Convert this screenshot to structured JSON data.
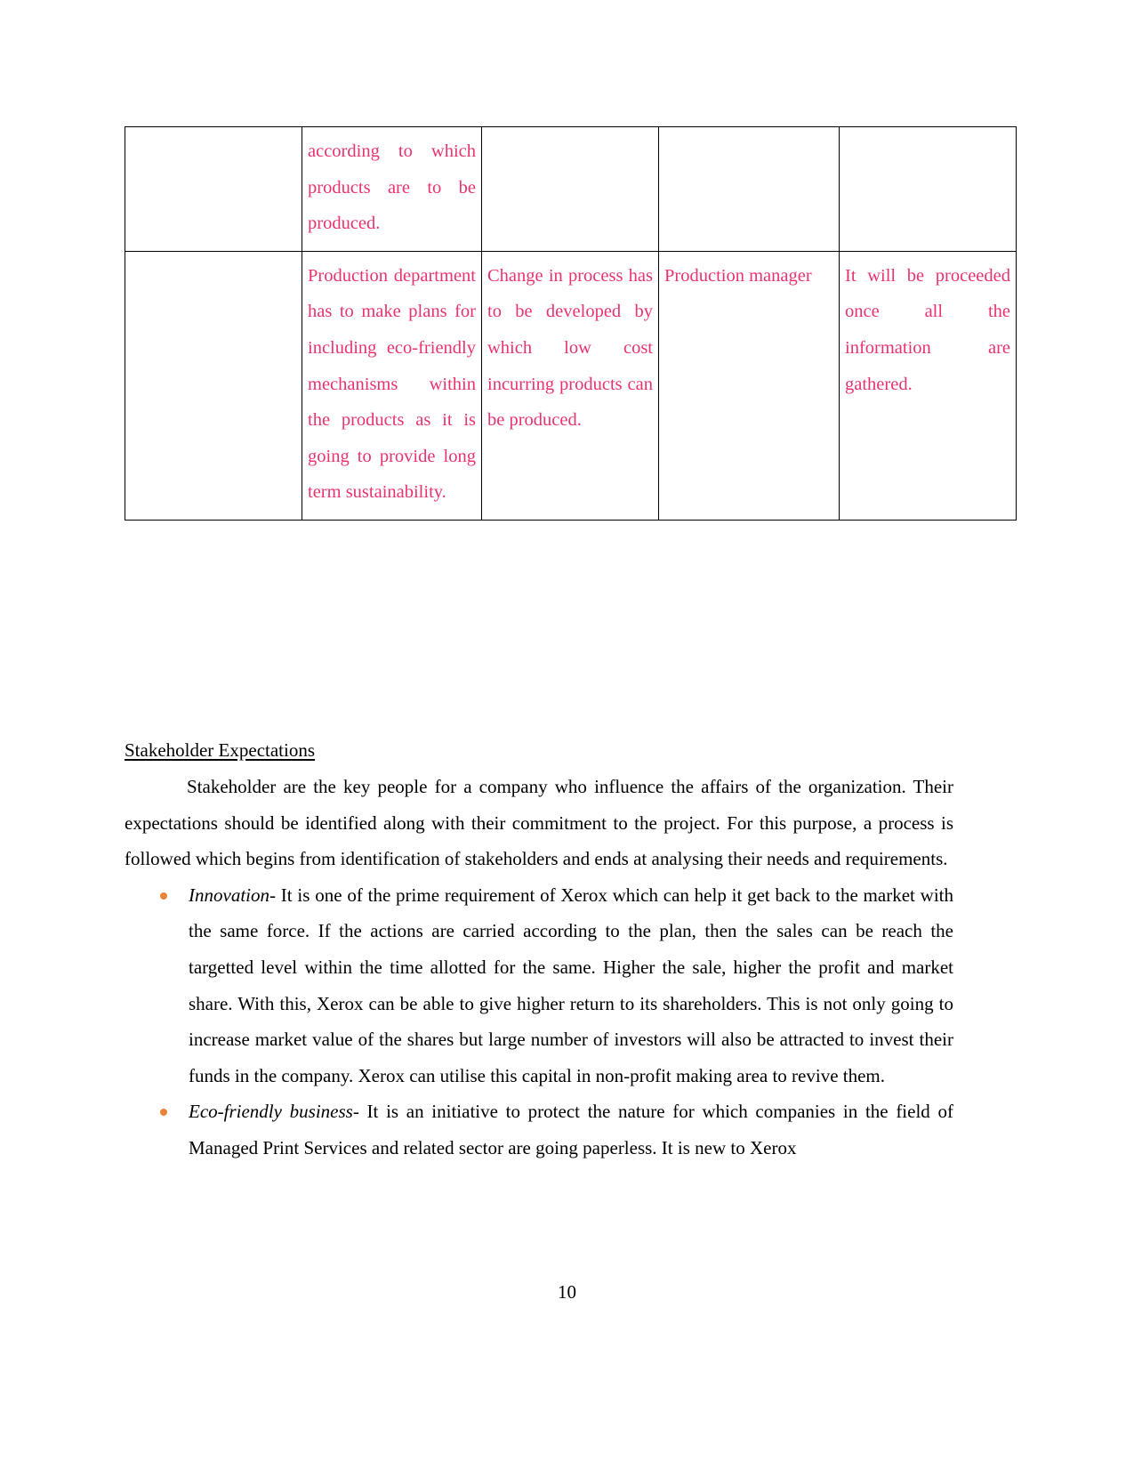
{
  "page": {
    "number": "10",
    "table_text_color": "#E8336D",
    "bullet_color": "#E8833A",
    "body_text_color": "#000000"
  },
  "table": {
    "rows": [
      {
        "cells": [
          {
            "text": ""
          },
          {
            "text": "according to which products are to be produced."
          },
          {
            "text": ""
          },
          {
            "text": ""
          },
          {
            "text": ""
          }
        ]
      },
      {
        "cells": [
          {
            "text": ""
          },
          {
            "text": "Production department has to make plans for including eco-friendly mechanisms within the products as it is going to provide long term sustainability."
          },
          {
            "text": "Change in process has to be developed by which low cost incurring products can be produced."
          },
          {
            "text": "Production manager"
          },
          {
            "text": "It will be proceeded once all the information are gathered."
          }
        ]
      }
    ]
  },
  "section": {
    "heading": "Stakeholder Expectations",
    "paragraph": "Stakeholder are the key people for a company who influence the affairs of the organization. Their expectations should be identified along with their commitment to the project. For this purpose, a process is followed which begins from identification of stakeholders and ends at analysing their needs and requirements.",
    "bullets": [
      {
        "lead_in": "Innovation",
        "separator": "- ",
        "text": "It is one of the prime requirement of Xerox which can help it get back to the market with the same force. If the actions are carried according to the plan, then the sales can be reach the targetted level within the time allotted for the same. Higher the sale, higher the profit and market share. With this, Xerox can be able to give higher return to its shareholders. This is not only going to increase market value of the shares but large number of investors will also be attracted to invest their funds in the company. Xerox can utilise this capital in non-profit making area to revive them."
      },
      {
        "lead_in": "Eco-friendly business",
        "separator": "- ",
        "text": "It is an initiative to protect the nature for which companies in the field of Managed Print Services and related sector are going paperless. It is new to Xerox"
      }
    ]
  }
}
